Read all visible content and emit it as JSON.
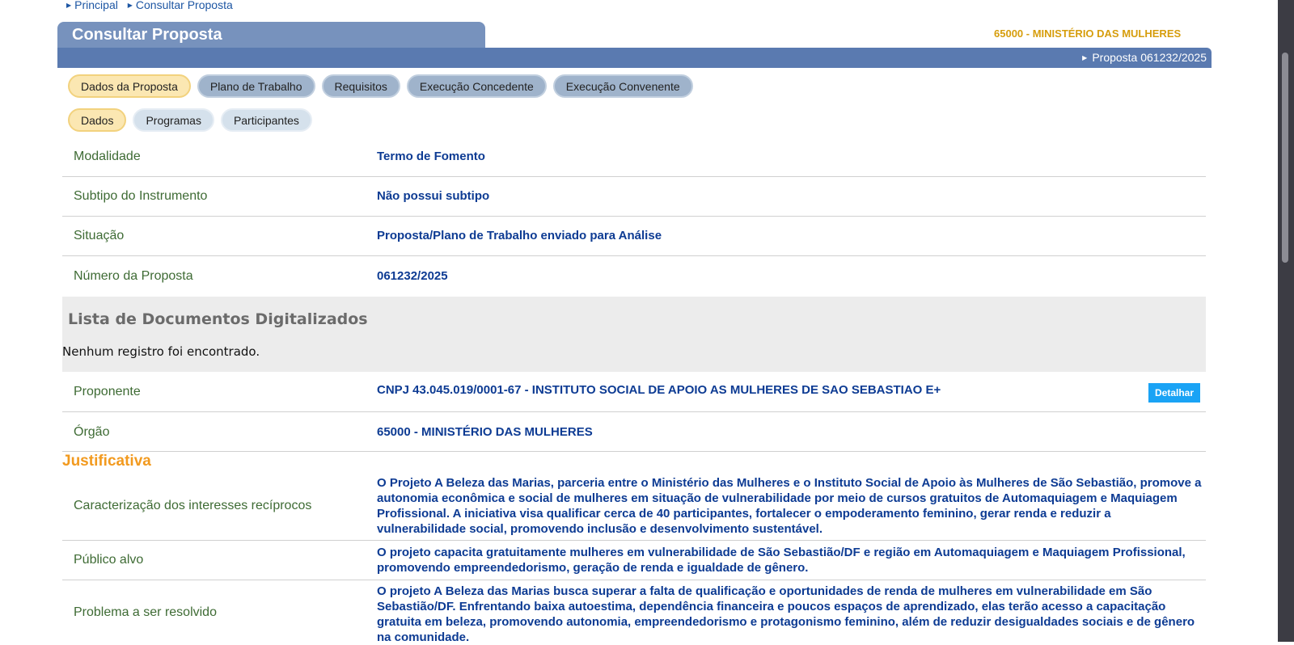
{
  "breadcrumb": [
    "Principal",
    "Consultar Proposta"
  ],
  "header": {
    "title": "Consultar Proposta",
    "organization": "65000 - MINISTÉRIO DAS MULHERES",
    "proposal_link": "Proposta 061232/2025"
  },
  "tabs": [
    {
      "label": "Dados da Proposta",
      "active": true
    },
    {
      "label": "Plano de Trabalho",
      "active": false
    },
    {
      "label": "Requisitos",
      "active": false
    },
    {
      "label": "Execução Concedente",
      "active": false
    },
    {
      "label": "Execução Convenente",
      "active": false
    }
  ],
  "subtabs": [
    {
      "label": "Dados",
      "active": true
    },
    {
      "label": "Programas",
      "active": false
    },
    {
      "label": "Participantes",
      "active": false
    }
  ],
  "fields": {
    "modalidade": {
      "label": "Modalidade",
      "value": "Termo de Fomento"
    },
    "subtipo": {
      "label": "Subtipo do Instrumento",
      "value": "Não possui subtipo"
    },
    "situacao": {
      "label": "Situação",
      "value": "Proposta/Plano de Trabalho enviado para Análise"
    },
    "numero": {
      "label": "Número da Proposta",
      "value": "061232/2025"
    }
  },
  "documents": {
    "heading": "Lista de Documentos Digitalizados",
    "empty_message": "Nenhum registro foi encontrado."
  },
  "proponente": {
    "label": "Proponente",
    "value": "CNPJ 43.045.019/0001-67 - INSTITUTO SOCIAL DE APOIO AS MULHERES DE SAO SEBASTIAO E+",
    "detail_button": "Detalhar"
  },
  "orgao": {
    "label": "Órgão",
    "value": "65000 - MINISTÉRIO DAS MULHERES"
  },
  "justificativa": {
    "title": "Justificativa",
    "caracterizacao": {
      "label": "Caracterização dos interesses recíprocos",
      "value": "O Projeto A Beleza das Marias, parceria entre o Ministério das Mulheres e o Instituto Social de Apoio às Mulheres de São Sebastião, promove a autonomia econômica e social de mulheres em situação de vulnerabilidade por meio de cursos gratuitos de Automaquiagem e Maquiagem Profissional. A iniciativa visa qualificar cerca de 40 participantes, fortalecer o empoderamento feminino, gerar renda e reduzir a vulnerabilidade social, promovendo inclusão e desenvolvimento sustentável."
    },
    "publico_alvo": {
      "label": "Público alvo",
      "value": "O projeto capacita gratuitamente mulheres em vulnerabilidade de São Sebastião/DF e região em Automaquiagem e Maquiagem Profissional, promovendo empreendedorismo, geração de renda e igualdade de gênero."
    },
    "problema": {
      "label": "Problema a ser resolvido",
      "value": "O projeto A Beleza das Marias busca superar a falta de qualificação e oportunidades de renda de mulheres em vulnerabilidade em São Sebastião/DF. Enfrentando baixa autoestima, dependência financeira e poucos espaços de aprendizado, elas terão acesso a capacitação gratuita em beleza, promovendo autonomia, empreendedorismo e protagonismo feminino, além de reduzir desigualdades sociais e de gênero na comunidade."
    }
  }
}
